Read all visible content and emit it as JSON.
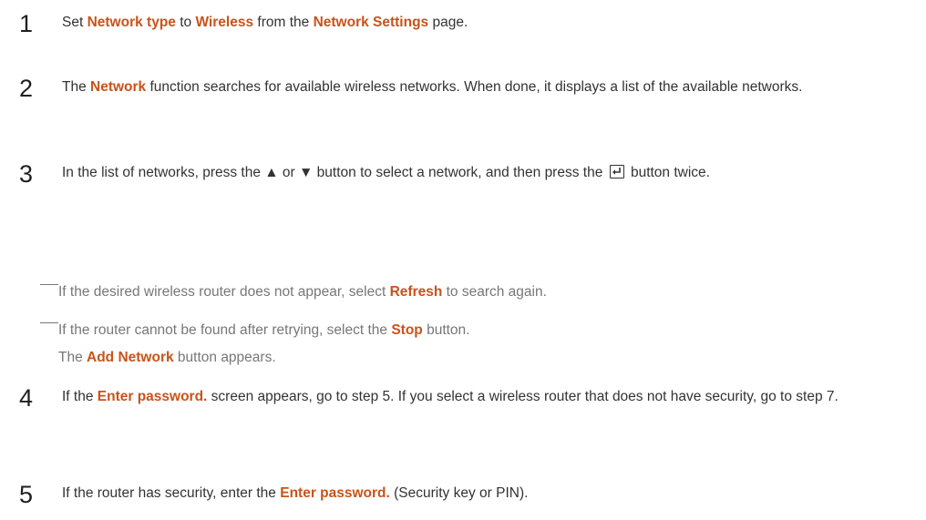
{
  "steps": [
    {
      "number": "1",
      "parts": [
        "Set ",
        "Network type",
        " to ",
        "Wireless",
        " from the ",
        "Network Settings",
        " page."
      ]
    },
    {
      "number": "2",
      "parts": [
        "The ",
        "Network",
        " function searches for available wireless networks. When done, it displays a list of the available networks."
      ]
    },
    {
      "number": "3",
      "text_before": "In the list of networks, press the ",
      "up_symbol": "▲",
      "or_text": " or ",
      "down_symbol": "▼",
      "text_mid": " button to select a network, and then press the ",
      "text_after": " button twice."
    },
    {
      "number": "4",
      "parts": [
        "If the ",
        "Enter password.",
        " screen appears, go to step 5. If you select a wireless router that does not have security, go to step 7."
      ]
    },
    {
      "number": "5",
      "parts": [
        "If the router has security, enter the ",
        "Enter password.",
        " (Security key or PIN)."
      ]
    }
  ],
  "notes": [
    {
      "parts": [
        "If the desired wireless router does not appear, select ",
        "Refresh",
        " to search again."
      ]
    },
    {
      "parts": [
        "If the router cannot be found after retrying, select the ",
        "Stop",
        " button."
      ]
    }
  ],
  "note_sub": {
    "parts": [
      "The ",
      "Add Network",
      " button appears."
    ]
  },
  "icons": {
    "enter": "enter-key-icon"
  },
  "colors": {
    "highlight": "#c8531a",
    "note_text": "#777777",
    "body_text": "#333333"
  }
}
